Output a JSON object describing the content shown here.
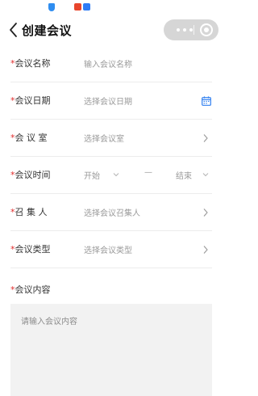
{
  "header": {
    "title": "创建会议"
  },
  "form": {
    "name": {
      "label": "会议名称",
      "placeholder": "输入会议名称"
    },
    "date": {
      "label": "会议日期",
      "placeholder": "选择会议日期"
    },
    "room": {
      "label": "会 议 室",
      "placeholder": "选择会议室"
    },
    "time": {
      "label": "会议时间",
      "start": "开始",
      "separator": "—",
      "end": "结束"
    },
    "convener": {
      "label": "召 集 人",
      "placeholder": "选择会议召集人"
    },
    "type": {
      "label": "会议类型",
      "placeholder": "选择会议类型"
    },
    "content": {
      "label": "会议内容",
      "placeholder": "请输入会议内容"
    },
    "required_mark": "*"
  },
  "colors": {
    "required": "#e12b2b",
    "accent": "#2f7ff0",
    "capsule": "#d6d6d6"
  }
}
